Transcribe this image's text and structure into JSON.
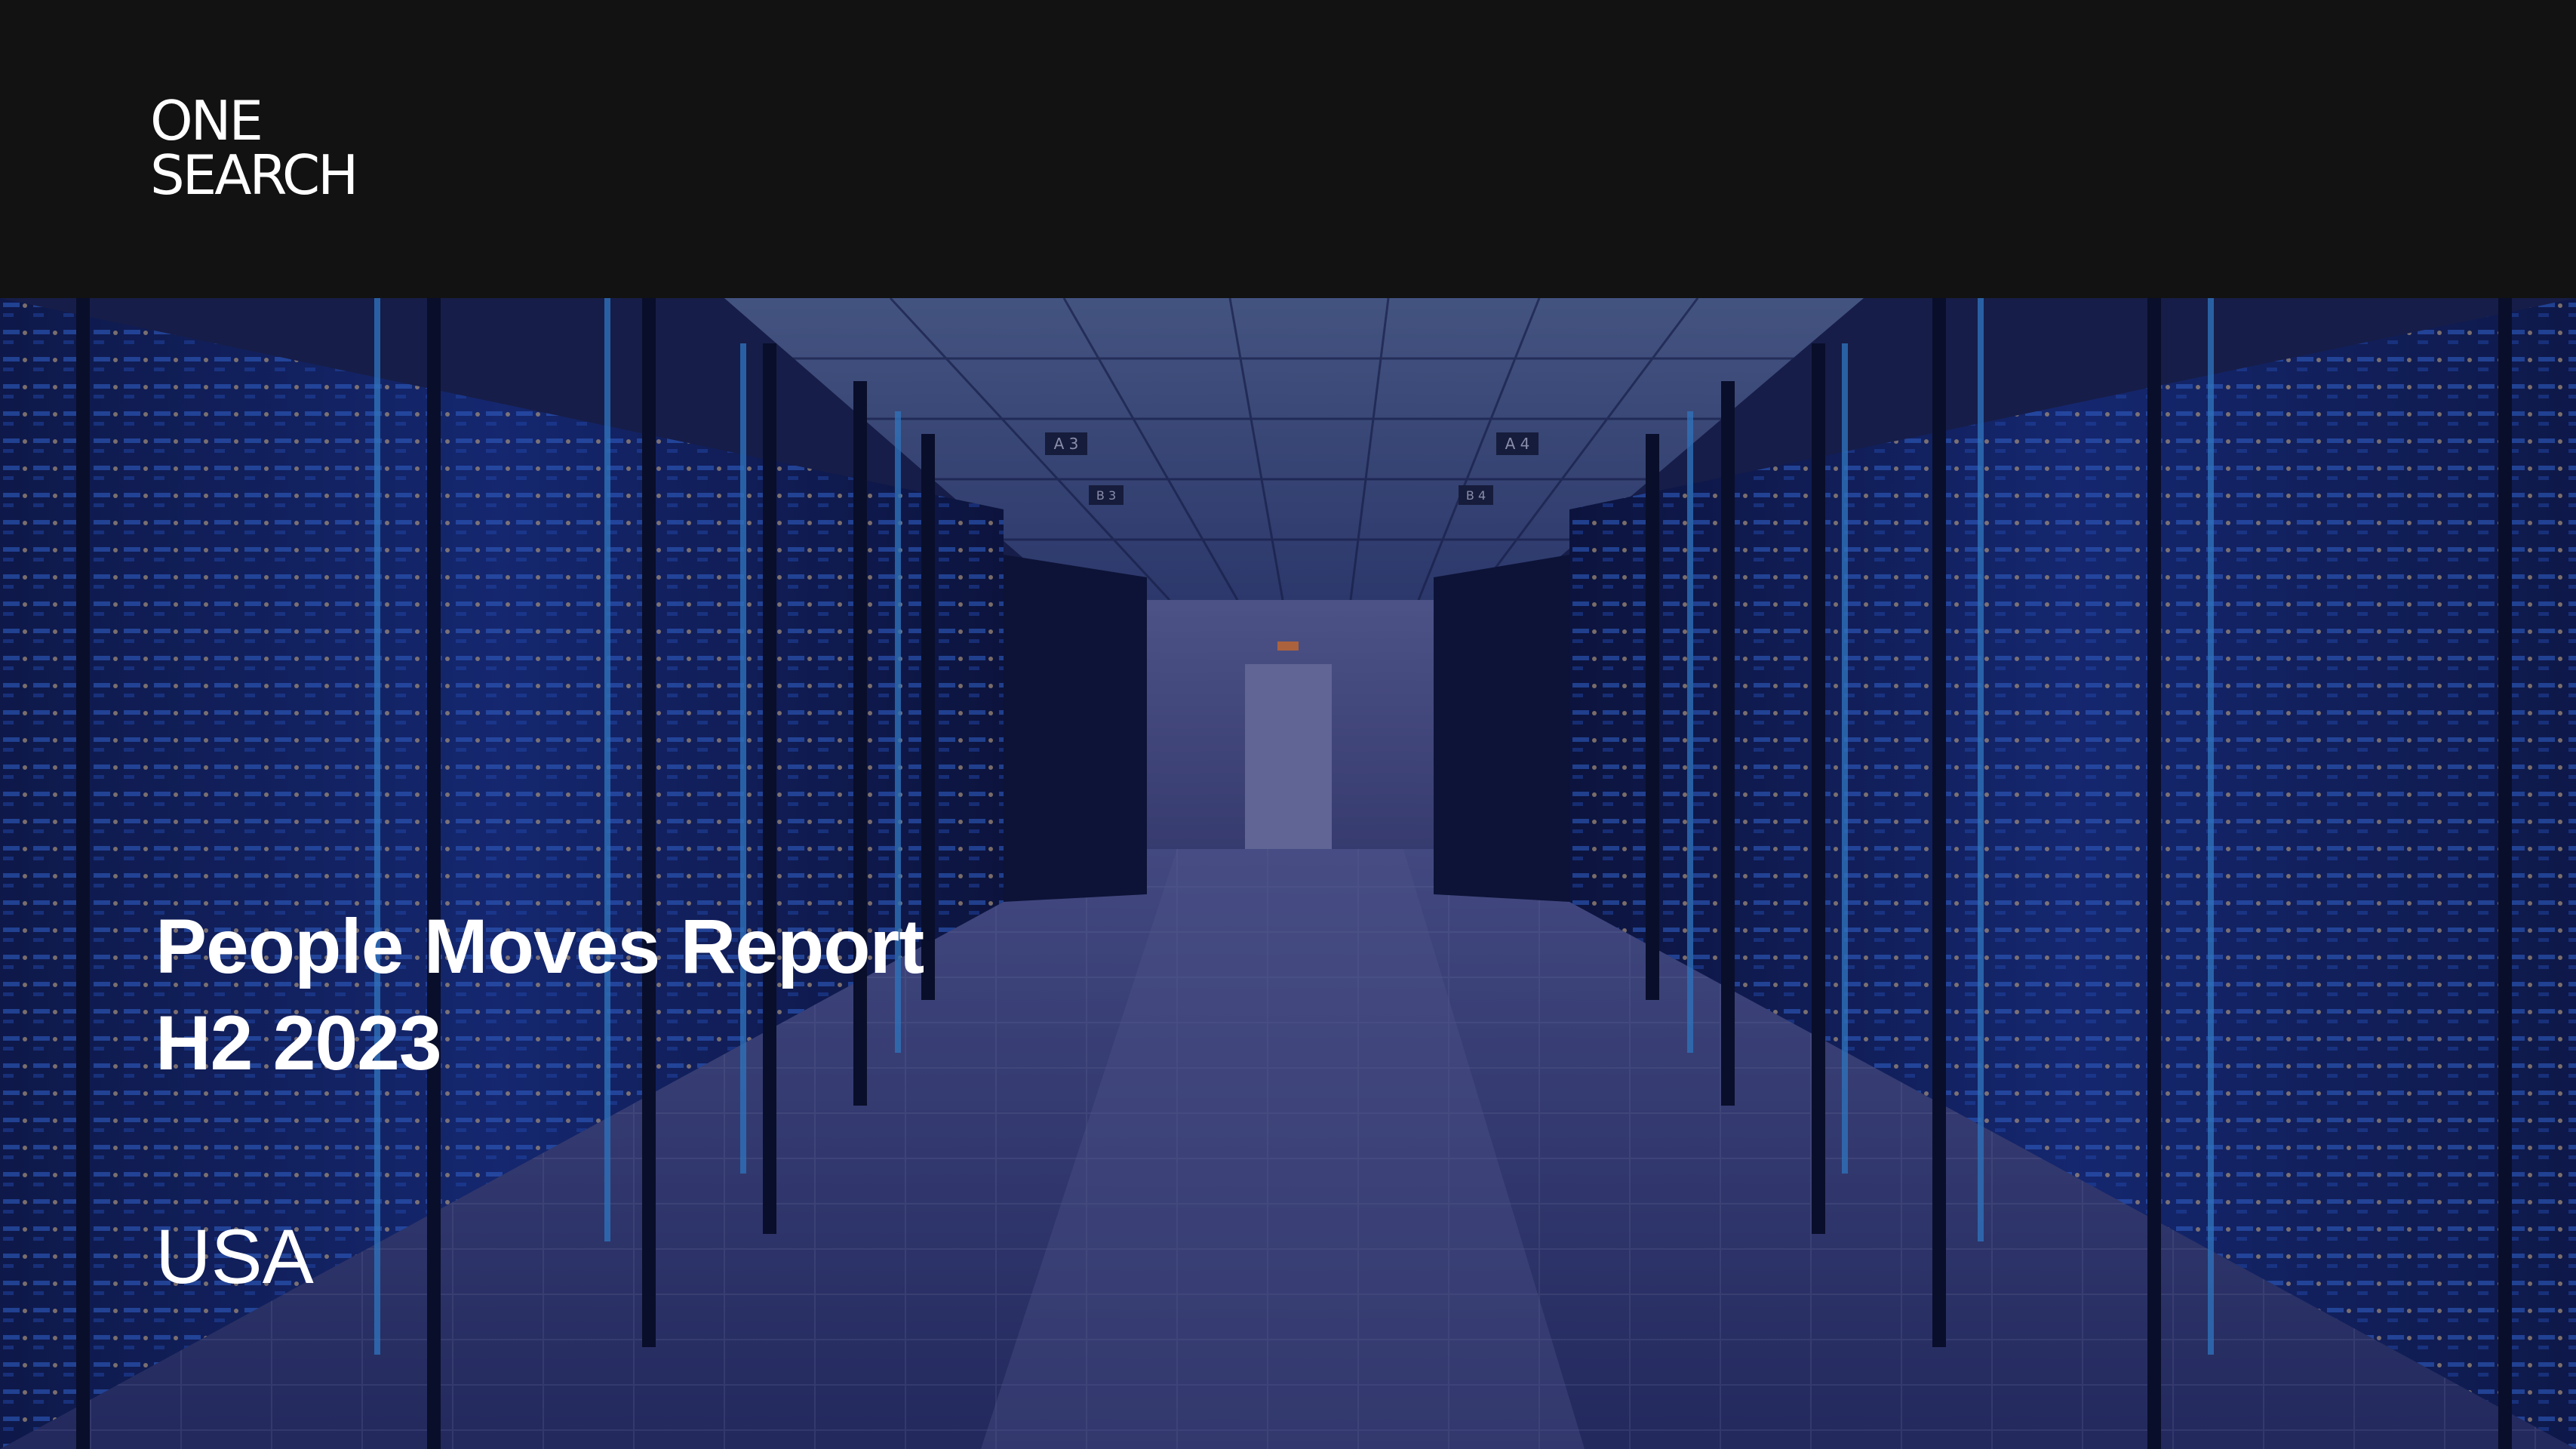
{
  "brand": {
    "line1": "ONE",
    "line2": "SEARCH"
  },
  "report": {
    "title_line1": "People Moves Report",
    "title_line2": "H2 2023",
    "region": "USA"
  },
  "signs": {
    "a3": "A 3",
    "b3": "B 3",
    "a4": "A 4",
    "b4": "B 4"
  },
  "colors": {
    "header_bg": "#121212",
    "text": "#ffffff",
    "rack_glow": "#2f6bff",
    "floor": "#4a5290"
  }
}
